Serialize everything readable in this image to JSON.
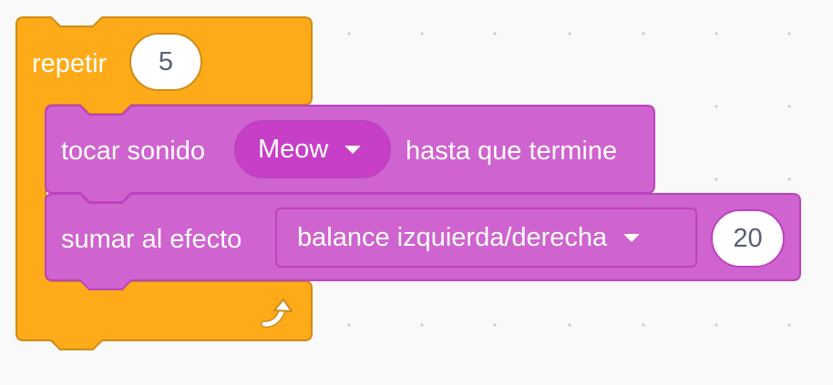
{
  "repeat_block": {
    "label": "repetir",
    "count": "5",
    "color": "#ffab19",
    "loop_icon": "loop-arrow-icon"
  },
  "play_sound_block": {
    "label_prefix": "tocar sonido",
    "sound": "Meow",
    "label_suffix": "hasta que termine",
    "color": "#cf63cf"
  },
  "change_effect_block": {
    "label": "sumar al efecto",
    "effect": "balance izquierda/derecha",
    "value": "20",
    "color": "#cf63cf"
  }
}
